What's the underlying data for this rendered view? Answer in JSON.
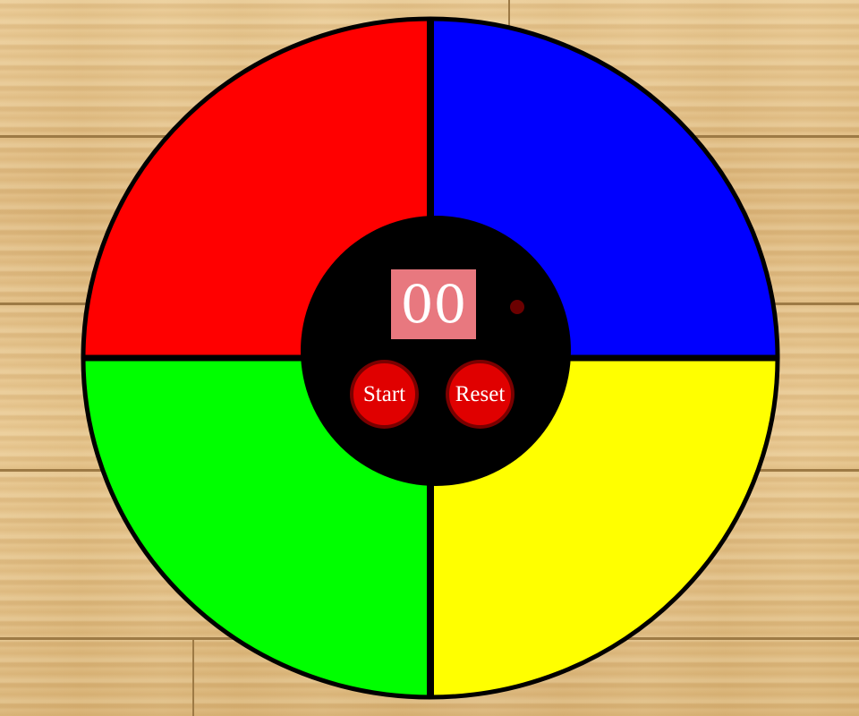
{
  "game": {
    "counter": "00",
    "start_label": "Start",
    "reset_label": "Reset",
    "colors": {
      "red": "#ff0000",
      "blue": "#0000ff",
      "green": "#00ff00",
      "yellow": "#ffff00",
      "center": "#000000",
      "counter_bg": "#e8787f",
      "button": "#e00000",
      "led_off": "#6b0000"
    }
  }
}
